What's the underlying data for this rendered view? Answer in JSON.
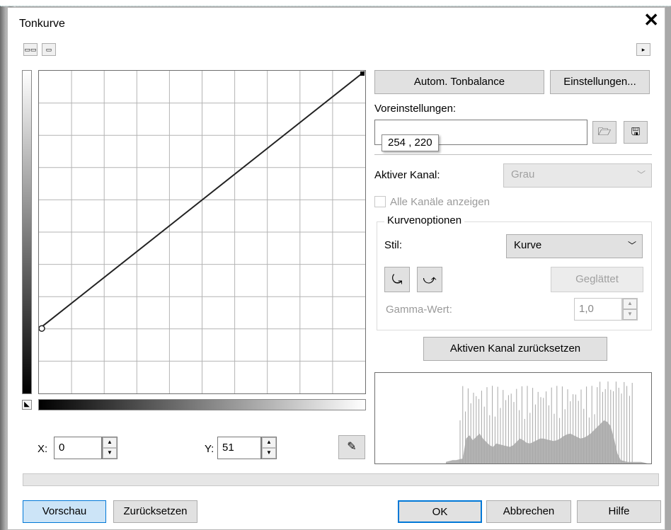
{
  "dialog": {
    "title": "Tonkurve",
    "close_label": "✕"
  },
  "toolbar": {
    "view_a_icon": "dual-view-icon",
    "view_b_icon": "single-view-icon",
    "expand_icon": "triangle-right-icon"
  },
  "curve": {
    "tooltip": "254 , 220",
    "points": [
      [
        0,
        51
      ],
      [
        255,
        255
      ]
    ]
  },
  "buttons": {
    "auto_balance": "Autom. Tonbalance",
    "settings": "Einstellungen...",
    "reset_channel": "Aktiven Kanal zurücksetzen",
    "smoothed": "Geglättet",
    "preview": "Vorschau",
    "reset": "Zurücksetzen",
    "ok": "OK",
    "cancel": "Abbrechen",
    "help": "Hilfe"
  },
  "presets": {
    "label": "Voreinstellungen:",
    "value": ""
  },
  "channel": {
    "label": "Aktiver Kanal:",
    "value": "Grau",
    "show_all_label": "Alle Kanäle anzeigen",
    "show_all_checked": false
  },
  "curve_options": {
    "legend": "Kurvenoptionen",
    "style_label": "Stil:",
    "style_value": "Kurve",
    "gamma_label": "Gamma-Wert:",
    "gamma_value": "1,0"
  },
  "coords": {
    "x_label": "X:",
    "x_value": "0",
    "y_label": "Y:",
    "y_value": "51"
  },
  "histogram": {
    "values": [
      2,
      3,
      4,
      4,
      5,
      6,
      30,
      34,
      28,
      32,
      36,
      30,
      26,
      22,
      20,
      24,
      23,
      22,
      21,
      20,
      22,
      26,
      30,
      28,
      25,
      24,
      26,
      28,
      30,
      30,
      29,
      28,
      27,
      28,
      30,
      33,
      35,
      36,
      34,
      32,
      30,
      31,
      33,
      36,
      40,
      44,
      48,
      52,
      50,
      45,
      30,
      12,
      4,
      3,
      2,
      2,
      2,
      2,
      2,
      1
    ],
    "spikes": [
      0.35,
      0.45,
      0.5,
      0.55,
      0.6,
      0.62,
      0.65,
      0.68,
      0.7,
      0.72,
      0.75,
      0.8,
      0.82,
      0.85,
      0.88,
      0.9,
      0.92
    ]
  },
  "colors": {
    "curve_line": "#222222",
    "histogram_fill": "#b3b3b3",
    "accent_border": "#0078d7"
  }
}
